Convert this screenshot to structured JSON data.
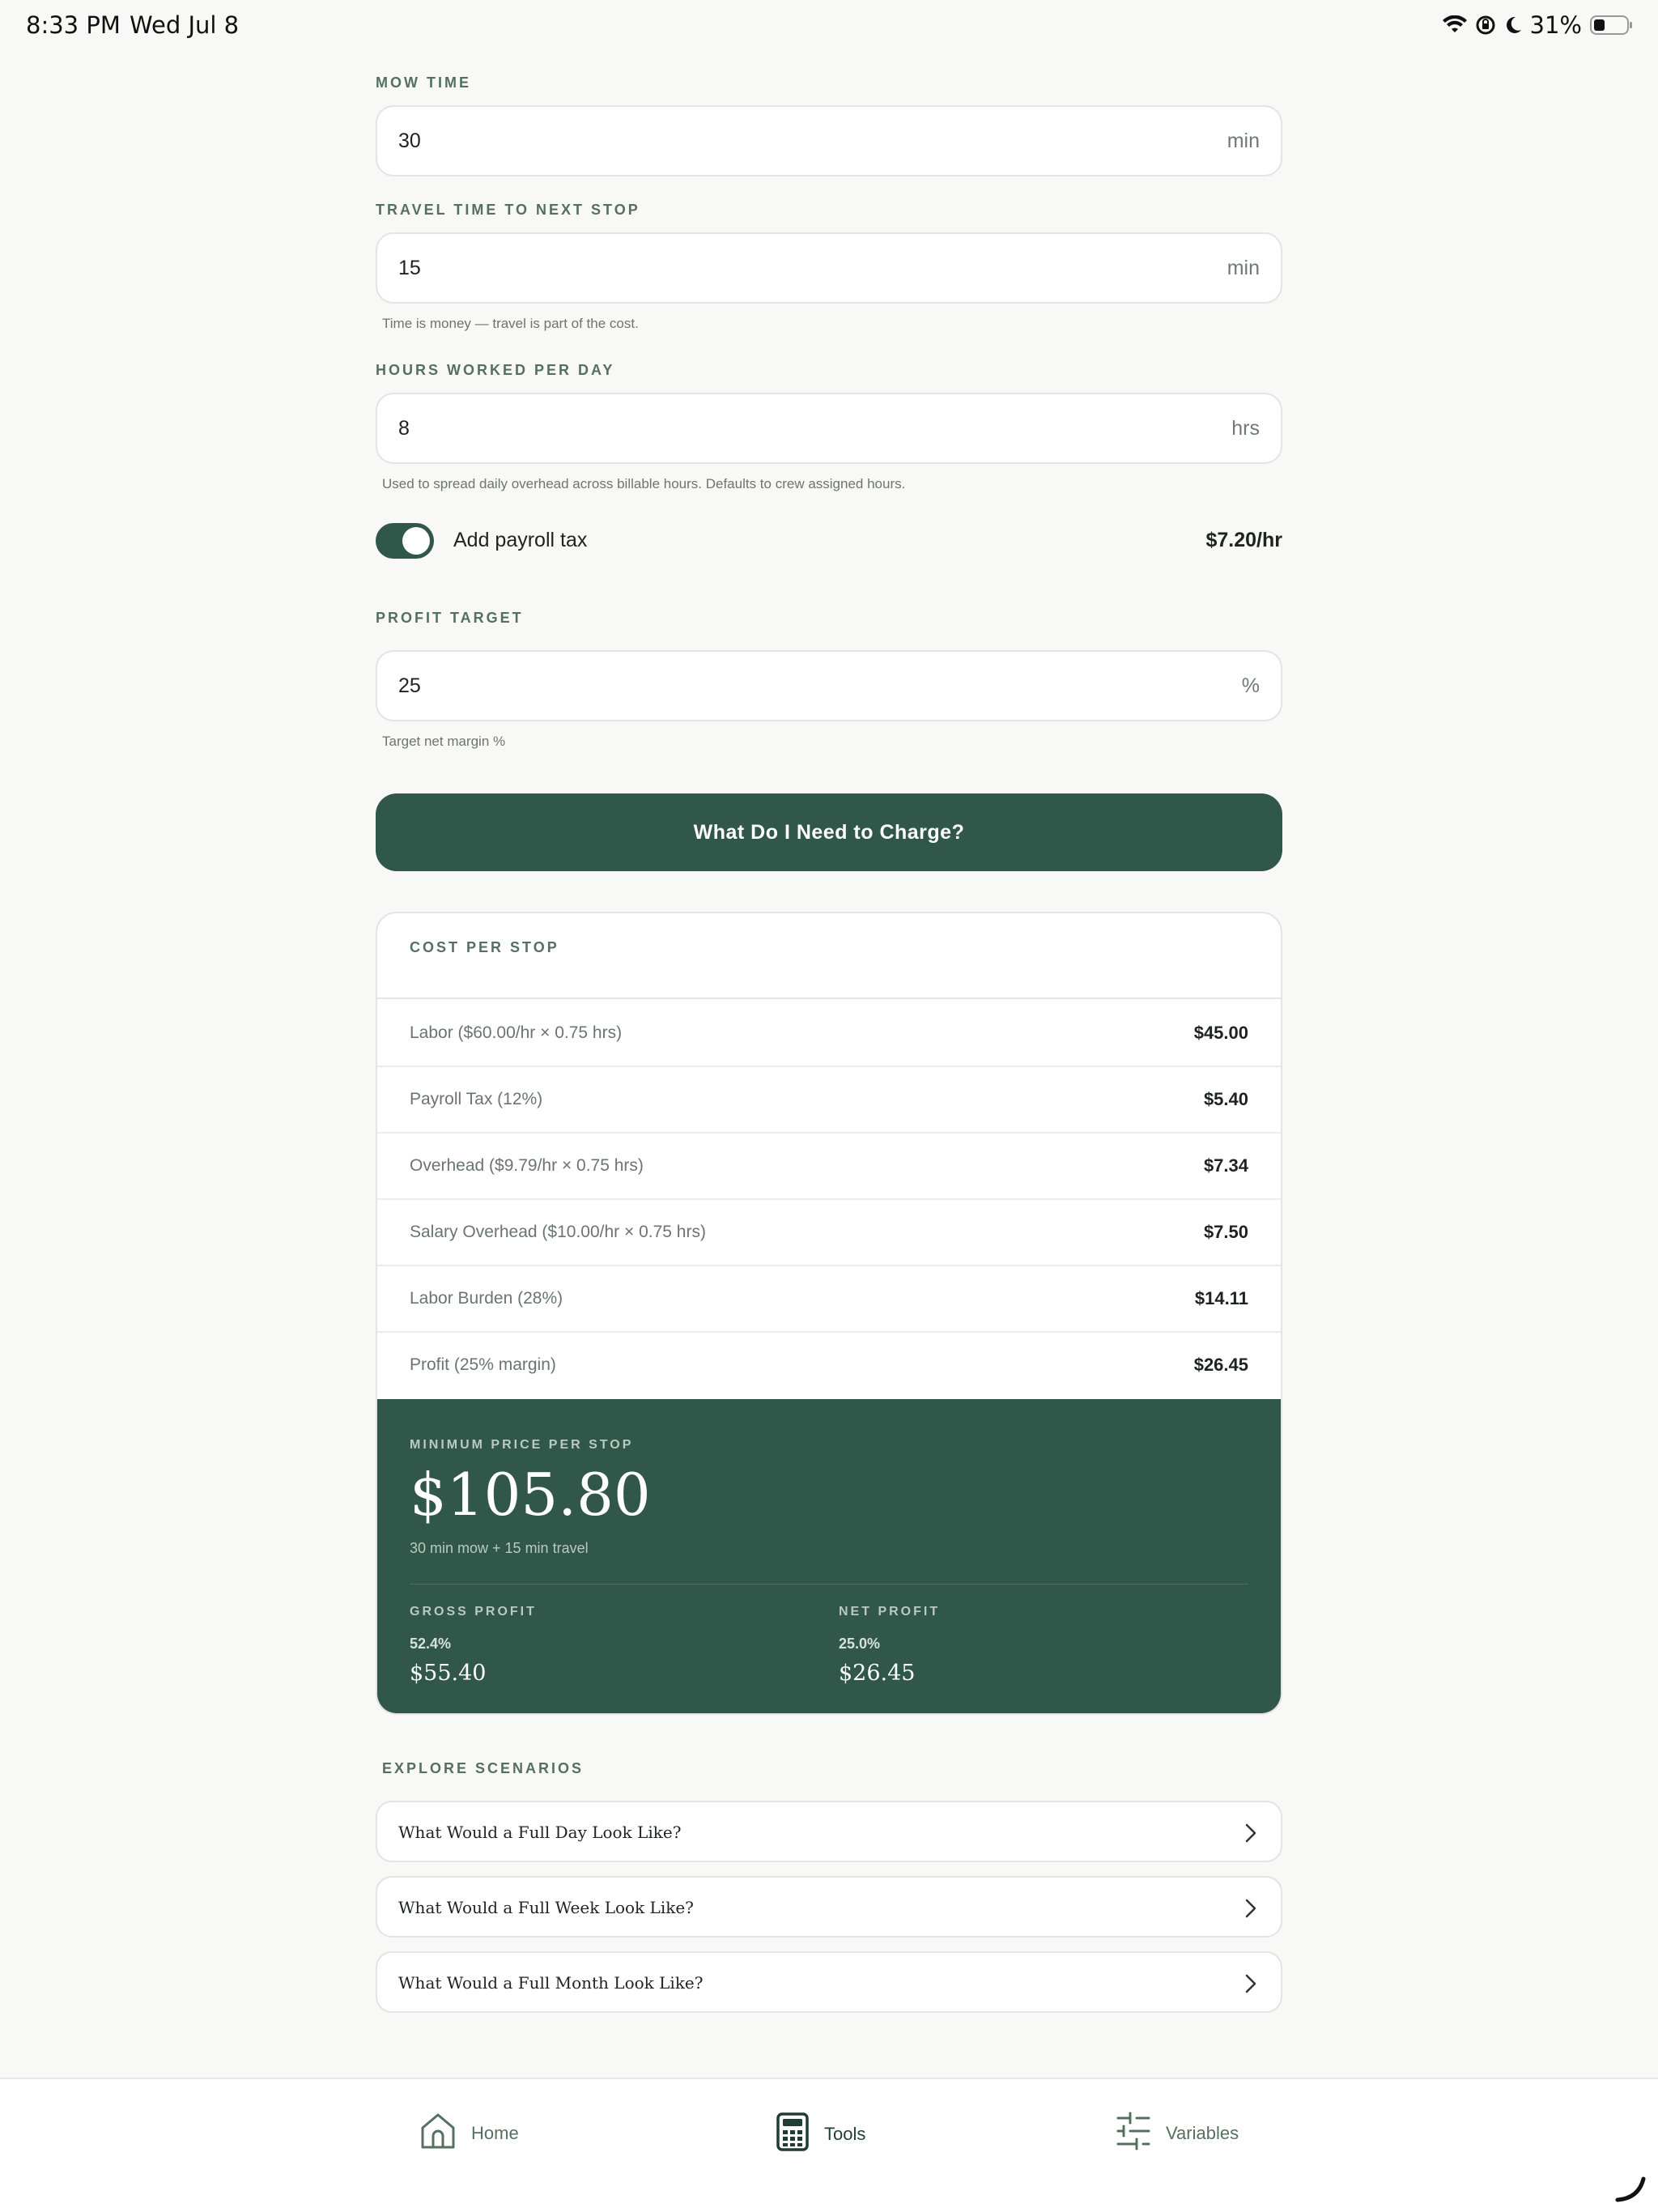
{
  "status_bar": {
    "time": "8:33 PM",
    "date": "Wed Jul 8",
    "battery": "31%"
  },
  "fields": {
    "mow_time": {
      "label": "MOW TIME",
      "value": "30",
      "unit": "min"
    },
    "travel_time": {
      "label": "TRAVEL TIME TO NEXT STOP",
      "value": "15",
      "unit": "min",
      "helper": "Time is money — travel is part of the cost."
    },
    "hours_per_day": {
      "label": "HOURS WORKED PER DAY",
      "value": "8",
      "unit": "hrs",
      "helper": "Used to spread daily overhead across billable hours. Defaults to crew assigned hours."
    },
    "profit_target": {
      "label": "PROFIT TARGET",
      "value": "25",
      "unit": "%",
      "helper": "Target net margin %"
    }
  },
  "payroll_toggle": {
    "label": "Add payroll tax",
    "value": "$7.20/hr",
    "on": true
  },
  "cta_label": "What Do I Need to Charge?",
  "cost_card": {
    "title": "COST PER STOP",
    "rows": [
      {
        "label": "Labor ($60.00/hr × 0.75 hrs)",
        "value": "$45.00"
      },
      {
        "label": "Payroll Tax (12%)",
        "value": "$5.40"
      },
      {
        "label": "Overhead ($9.79/hr × 0.75 hrs)",
        "value": "$7.34"
      },
      {
        "label": "Salary Overhead ($10.00/hr × 0.75 hrs)",
        "value": "$7.50"
      },
      {
        "label": "Labor Burden (28%)",
        "value": "$14.11"
      },
      {
        "label": "Profit (25% margin)",
        "value": "$26.45"
      }
    ],
    "summary": {
      "label": "MINIMUM PRICE PER STOP",
      "price": "$105.80",
      "sub": "30 min mow + 15 min travel",
      "gross": {
        "label": "GROSS PROFIT",
        "pct": "52.4%",
        "amount": "$55.40"
      },
      "net": {
        "label": "NET PROFIT",
        "pct": "25.0%",
        "amount": "$26.45"
      }
    }
  },
  "scenarios": {
    "title": "EXPLORE SCENARIOS",
    "items": [
      "What Would a Full Day Look Like?",
      "What Would a Full Week Look Like?",
      "What Would a Full Month Look Like?"
    ]
  },
  "tabbar": {
    "home": "Home",
    "tools": "Tools",
    "variables": "Variables",
    "active": "tools"
  },
  "colors": {
    "accent": "#30574a",
    "label": "#55705f",
    "background": "#f8f8f6"
  }
}
